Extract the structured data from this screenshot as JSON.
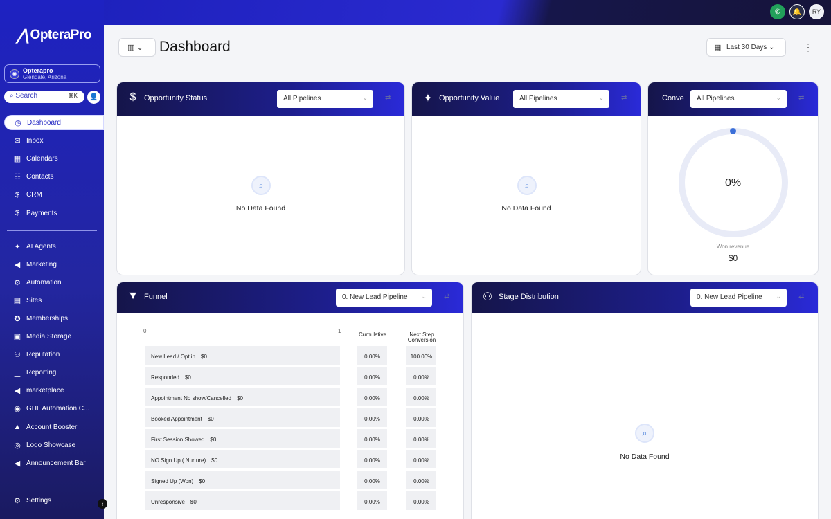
{
  "topbar": {
    "avatar_initials": "RY"
  },
  "sidebar": {
    "brand": "OpteraPro",
    "account": {
      "name": "Opterapro",
      "location": "Glendale, Arizona"
    },
    "search": {
      "label": "Search",
      "shortcut": "⌘K"
    },
    "items": [
      {
        "label": "Dashboard",
        "icon": "dashboard-icon",
        "active": true
      },
      {
        "label": "Inbox",
        "icon": "chat-icon"
      },
      {
        "label": "Calendars",
        "icon": "calendar-icon"
      },
      {
        "label": "Contacts",
        "icon": "contacts-icon"
      },
      {
        "label": "CRM",
        "icon": "crm-icon"
      },
      {
        "label": "Payments",
        "icon": "payments-icon"
      }
    ],
    "items2": [
      {
        "label": "AI Agents",
        "icon": "sparkle-icon"
      },
      {
        "label": "Marketing",
        "icon": "megaphone-icon"
      },
      {
        "label": "Automation",
        "icon": "gear-icon"
      },
      {
        "label": "Sites",
        "icon": "sites-icon"
      },
      {
        "label": "Memberships",
        "icon": "badge-icon"
      },
      {
        "label": "Media Storage",
        "icon": "image-icon"
      },
      {
        "label": "Reputation",
        "icon": "users-icon"
      },
      {
        "label": "Reporting",
        "icon": "chart-icon"
      },
      {
        "label": "marketplace",
        "icon": "megaphone-icon"
      },
      {
        "label": "GHL Automation C...",
        "icon": "car-icon"
      },
      {
        "label": "Account Booster",
        "icon": "booster-icon"
      },
      {
        "label": "Logo Showcase",
        "icon": "eye-icon"
      },
      {
        "label": "Announcement Bar",
        "icon": "megaphone-icon"
      }
    ],
    "settings": "Settings"
  },
  "header": {
    "title": "Dashboard",
    "date_range": "Last 30 Days"
  },
  "cards": {
    "opp_status": {
      "title": "Opportunity Status",
      "filter": "All Pipelines",
      "empty": "No Data Found"
    },
    "opp_value": {
      "title": "Opportunity Value",
      "filter": "All Pipelines",
      "empty": "No Data Found"
    },
    "conversion": {
      "title": "Conve",
      "filter": "All Pipelines",
      "percent": "0%",
      "won_label": "Won revenue",
      "won_value": "$0"
    },
    "funnel": {
      "title": "Funnel",
      "filter": "0. New Lead Pipeline",
      "axis_min": "0",
      "axis_max": "1",
      "col_cumulative": "Cumulative",
      "col_next": "Next Step Conversion",
      "rows": [
        {
          "stage": "New Lead / Opt in",
          "value": "$0",
          "cumulative": "0.00%",
          "next": "100.00%"
        },
        {
          "stage": "Responded",
          "value": "$0",
          "cumulative": "0.00%",
          "next": "0.00%"
        },
        {
          "stage": "Appointment No show/Cancelled",
          "value": "$0",
          "cumulative": "0.00%",
          "next": "0.00%"
        },
        {
          "stage": "Booked Appointment",
          "value": "$0",
          "cumulative": "0.00%",
          "next": "0.00%"
        },
        {
          "stage": "First Session Showed",
          "value": "$0",
          "cumulative": "0.00%",
          "next": "0.00%"
        },
        {
          "stage": "NO Sign Up ( Nurture)",
          "value": "$0",
          "cumulative": "0.00%",
          "next": "0.00%"
        },
        {
          "stage": "Signed Up (Won)",
          "value": "$0",
          "cumulative": "0.00%",
          "next": "0.00%"
        },
        {
          "stage": "Unresponsive",
          "value": "$0",
          "cumulative": "0.00%",
          "next": "0.00%"
        }
      ]
    },
    "stage_dist": {
      "title": "Stage Distribution",
      "filter": "0. New Lead Pipeline",
      "empty": "No Data Found"
    }
  }
}
